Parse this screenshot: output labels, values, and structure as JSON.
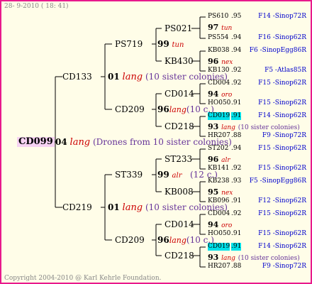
{
  "header": {
    "date": "28- 9-2010 ( 18: 41)"
  },
  "footer": {
    "copyright": "Copyright 2004-2010 @ Karl Kehrle Foundation."
  },
  "tree": {
    "root": {
      "name": "CD099",
      "year": "04",
      "breeder": "lang",
      "note": "(Drones from 10 sister colonies)"
    },
    "g1": [
      {
        "name": "CD133",
        "year": "01",
        "breeder": "lang",
        "note": "(10 sister colonies)"
      },
      {
        "name": "CD219",
        "year": "01",
        "breeder": "lang",
        "note": "(10 sister colonies)"
      }
    ],
    "g2": [
      {
        "name": "PS719",
        "year": "99",
        "breeder": "tun",
        "note": ""
      },
      {
        "name": "CD209",
        "year": "96",
        "breeder": "lang",
        "note": "(10 c.)"
      },
      {
        "name": "ST339",
        "year": "99",
        "breeder": "alr",
        "note": "(12 c.)"
      },
      {
        "name": "CD209",
        "year": "96",
        "breeder": "lang",
        "note": "(10 c.)"
      }
    ],
    "g3": [
      "PS021",
      "KB430",
      "CD014",
      "CD218",
      "ST233",
      "KB008",
      "CD014",
      "CD218"
    ],
    "g4": [
      {
        "kind": "leaf",
        "name": "PS610",
        "score": ".95",
        "src": "F14 -Sinop72R"
      },
      {
        "kind": "yr",
        "year": "97",
        "breeder": "tun"
      },
      {
        "kind": "leaf",
        "name": "PS554",
        "score": ".94",
        "src": "F16 -Sinop62R"
      },
      {
        "kind": "leaf",
        "name": "KB038",
        "score": ".94",
        "src": "F6 -SinopEgg86R"
      },
      {
        "kind": "yr",
        "year": "96",
        "breeder": "nex"
      },
      {
        "kind": "leaf",
        "name": "KB130",
        "score": ".92",
        "src": "F5 -Atlas85R"
      },
      {
        "kind": "leaf",
        "name": "CD004",
        "score": ".92",
        "src": "F15 -Sinop62R"
      },
      {
        "kind": "yr",
        "year": "94",
        "breeder": "oro"
      },
      {
        "kind": "leaf",
        "name": "HO050",
        "score": ".91",
        "src": "F15 -Sinop62R"
      },
      {
        "kind": "leaf",
        "name": "CD019",
        "score": ".91",
        "src": "F14 -Sinop62R",
        "hl": true
      },
      {
        "kind": "yr",
        "year": "93",
        "breeder": "lang",
        "note": "(10 sister colonies)"
      },
      {
        "kind": "leaf",
        "name": "HR207",
        "score": ".88",
        "src": "F9 -Sinop72R"
      },
      {
        "kind": "leaf",
        "name": "ST202",
        "score": ".94",
        "src": "F15 -Sinop62R"
      },
      {
        "kind": "yr",
        "year": "96",
        "breeder": "alr"
      },
      {
        "kind": "leaf",
        "name": "KB141",
        "score": ".92",
        "src": "F15 -Sinop62R"
      },
      {
        "kind": "leaf",
        "name": "KB238",
        "score": ".93",
        "src": "F5 -SinopEgg86R"
      },
      {
        "kind": "yr",
        "year": "95",
        "breeder": "nex"
      },
      {
        "kind": "leaf",
        "name": "KB096",
        "score": ".91",
        "src": "F12 -Sinop62R"
      },
      {
        "kind": "leaf",
        "name": "CD004",
        "score": ".92",
        "src": "F15 -Sinop62R"
      },
      {
        "kind": "yr",
        "year": "94",
        "breeder": "oro"
      },
      {
        "kind": "leaf",
        "name": "HO050",
        "score": ".91",
        "src": "F15 -Sinop62R"
      },
      {
        "kind": "leaf",
        "name": "CD019",
        "score": ".91",
        "src": "F14 -Sinop62R",
        "hl": true
      },
      {
        "kind": "yr",
        "year": "93",
        "breeder": "lang",
        "note": "(10 sister colonies)"
      },
      {
        "kind": "leaf",
        "name": "HR207",
        "score": ".88",
        "src": "F9 -Sinop72R"
      }
    ]
  }
}
